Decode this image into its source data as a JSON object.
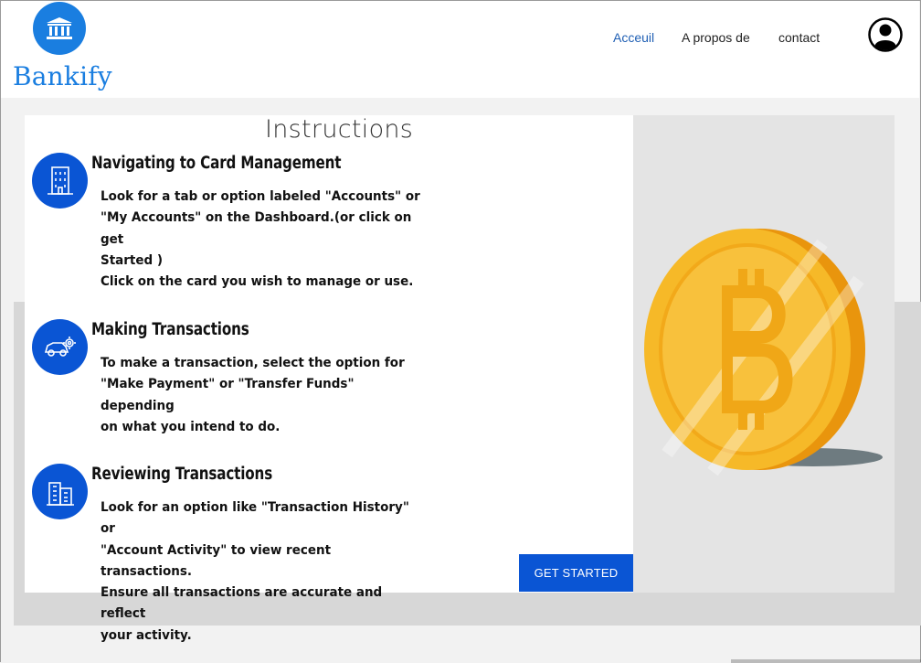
{
  "header": {
    "brand": "Bankify",
    "logo_icon": "bank-building-icon",
    "nav": [
      {
        "label": "Acceuil",
        "active": true
      },
      {
        "label": "A propos de",
        "active": false
      },
      {
        "label": "contact",
        "active": false
      }
    ],
    "avatar_icon": "user-avatar-icon"
  },
  "main": {
    "title": "Instructions",
    "sections": [
      {
        "icon": "office-building-icon",
        "heading": "Navigating to Card Management",
        "text": "Look for a tab or option labeled \"Accounts\" or\n\"My Accounts\" on the Dashboard.(or click on get\nStarted )\nClick on the card you wish to manage or use."
      },
      {
        "icon": "car-gear-icon",
        "heading": "Making Transactions",
        "text": "To make a transaction, select the option for\n\"Make Payment\" or \"Transfer Funds\" depending\non what you intend to do."
      },
      {
        "icon": "city-buildings-icon",
        "heading": "Reviewing Transactions",
        "text": "Look for an option like \"Transaction History\" or\n\"Account Activity\" to view recent transactions.\nEnsure all transactions are accurate and reflect\nyour activity."
      }
    ],
    "cta_label": "GET STARTED",
    "illustration_icon": "bitcoin-coin-icon"
  },
  "colors": {
    "brand_blue": "#1a7ee0",
    "primary_blue": "#0a55d4",
    "coin_gold": "#f5b624"
  }
}
